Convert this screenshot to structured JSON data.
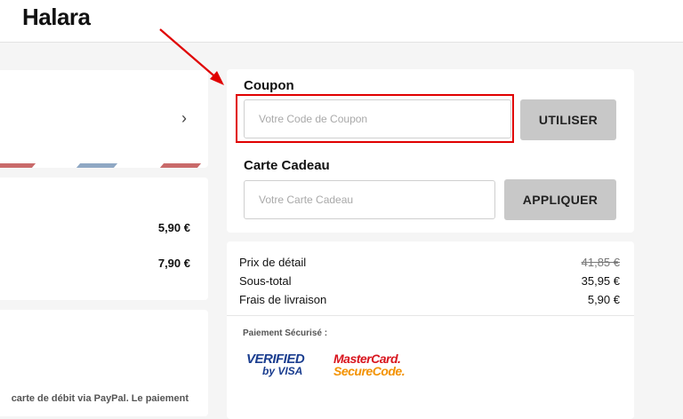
{
  "header": {
    "logo": "Halara"
  },
  "left": {
    "shipping_prices": [
      "5,90 €",
      "7,90 €"
    ],
    "paypal_text": "carte de débit via PayPal. Le paiement"
  },
  "coupon": {
    "label": "Coupon",
    "placeholder": "Votre Code de Coupon",
    "button": "UTILISER"
  },
  "gift_card": {
    "label": "Carte Cadeau",
    "placeholder": "Votre Carte Cadeau",
    "button": "APPLIQUER"
  },
  "summary": {
    "rows": [
      {
        "label": "Prix de détail",
        "value": "41,85 €"
      },
      {
        "label": "Sous-total",
        "value": "35,95 €"
      },
      {
        "label": "Frais de livraison",
        "value": "5,90 €"
      }
    ],
    "secure_label": "Paiement Sécurisé :",
    "badges": {
      "visa_line1": "VERIFIED",
      "visa_line2": "by VISA",
      "mc_line1": "MasterCard.",
      "mc_line2": "SecureCode."
    }
  },
  "colors": {
    "highlight": "#e00000",
    "arrow": "#e00000",
    "button_bg": "#c8c8c8",
    "stripe_red": "#c96a6a",
    "stripe_blue": "#8fa8c4"
  }
}
